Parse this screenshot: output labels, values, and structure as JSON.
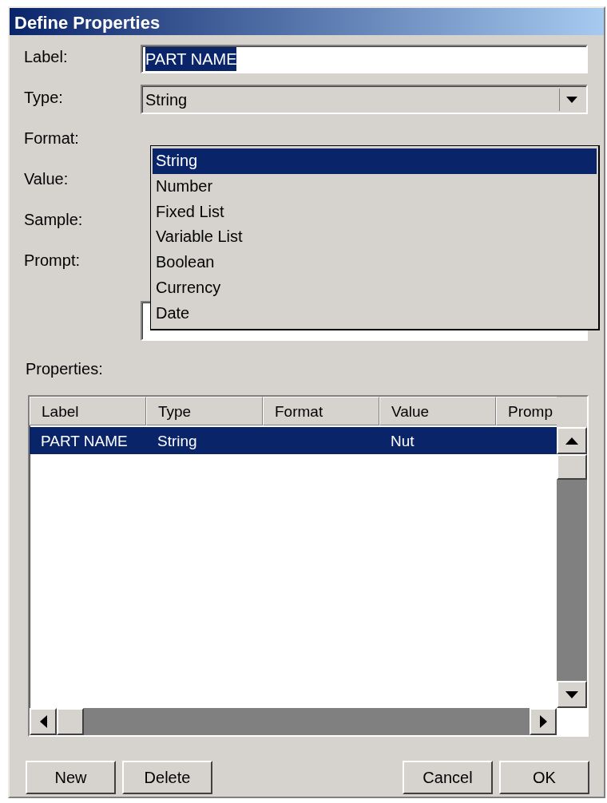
{
  "window": {
    "title": "Define Properties"
  },
  "labels": [
    "Label:",
    "Type:",
    "Format:",
    "Value:",
    "Sample:",
    "Prompt:"
  ],
  "label_field": {
    "value": "PART NAME",
    "selected": true
  },
  "type_combo": {
    "value": "String",
    "expanded": true,
    "options": [
      {
        "text": "String",
        "selected": true
      },
      {
        "text": "Number",
        "selected": false
      },
      {
        "text": "Fixed List",
        "selected": false
      },
      {
        "text": "Variable List",
        "selected": false
      },
      {
        "text": "Boolean",
        "selected": false
      },
      {
        "text": "Currency",
        "selected": false
      },
      {
        "text": "Date",
        "selected": false
      }
    ]
  },
  "properties": {
    "title": "Properties:",
    "columns": [
      "Label",
      "Type",
      "Format",
      "Value",
      "Promp"
    ],
    "rows": [
      {
        "label": "PART NAME",
        "type": "String",
        "value": "Nut",
        "selected": true
      }
    ]
  },
  "buttons_left": [
    "New",
    "Delete"
  ],
  "buttons_right": [
    "Cancel",
    "OK"
  ]
}
